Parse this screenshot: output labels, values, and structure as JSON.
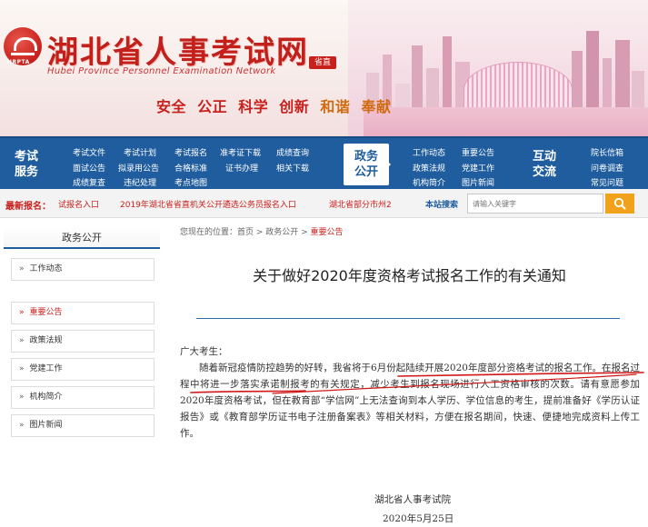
{
  "header": {
    "logo_tag": "HRPTA",
    "title": "湖北省人事考试网",
    "subtitle": "Hubei Province Personnel Examination Network",
    "province_badge": "省直",
    "slogan": [
      "安全",
      "公正",
      "科学",
      "创新",
      "和谐",
      "奉献"
    ]
  },
  "nav": {
    "group1": {
      "label": "考试\n服务",
      "links": [
        "考试文件",
        "考试计划",
        "考试报名",
        "准考证下载",
        "成绩查询",
        "面试公告",
        "拟录用公告",
        "合格标准",
        "证书办理",
        "相关下载",
        "成绩复查",
        "违纪处理",
        "考点地图"
      ]
    },
    "group2": {
      "label": "政务\n公开",
      "links": [
        "工作动态",
        "重要公告",
        "政策法规",
        "党建工作",
        "机构简介",
        "图片新闻"
      ]
    },
    "group3": {
      "label": "互动\n交流",
      "links": [
        "院长信箱",
        "问卷调查",
        "常见问题"
      ]
    }
  },
  "ticker": {
    "label": "最新报名：",
    "items": [
      "试报名入口",
      "2019年湖北省省直机关公开遴选公务员报名入口",
      "湖北省部分市州2"
    ],
    "search_label": "本站搜索",
    "search_placeholder": "请输入关键字"
  },
  "sidebar": {
    "heading": "政务公开",
    "items": [
      {
        "label": "工作动态",
        "active": false
      },
      {
        "label": "重要公告",
        "active": true
      },
      {
        "label": "政策法规",
        "active": false
      },
      {
        "label": "党建工作",
        "active": false
      },
      {
        "label": "机构简介",
        "active": false
      },
      {
        "label": "图片新闻",
        "active": false
      }
    ]
  },
  "breadcrumb": {
    "prefix": "您现在的位置：",
    "path": "首页 > 政务公开 > ",
    "current": "重要公告"
  },
  "article": {
    "title": "关于做好2020年度资格考试报名工作的有关通知",
    "greeting": "广大考生：",
    "body": "随着新冠疫情防控趋势的好转，我省将于6月份起陆续开展2020年度部分资格考试的报名工作。在报名过程中将进一步落实承诺制报考的有关规定，减少考生到报名现场进行人工资格审核的次数。请有意愿参加2020年度资格考试，但在教育部“学信网”上无法查询到本人学历、学位信息的考生，提前准备好《学历认证报告》或《教育部学历证书电子注册备案表》等相关材料，方便在报名期间，快速、便捷地完成资料上传工作。",
    "signature": "湖北省人事考试院",
    "date": "2020年5月25日"
  },
  "colors": {
    "brand_red": "#c8201c",
    "nav_blue": "#1f5d9e",
    "search_orange": "#f0a21a",
    "annotation_red": "#d01818"
  }
}
